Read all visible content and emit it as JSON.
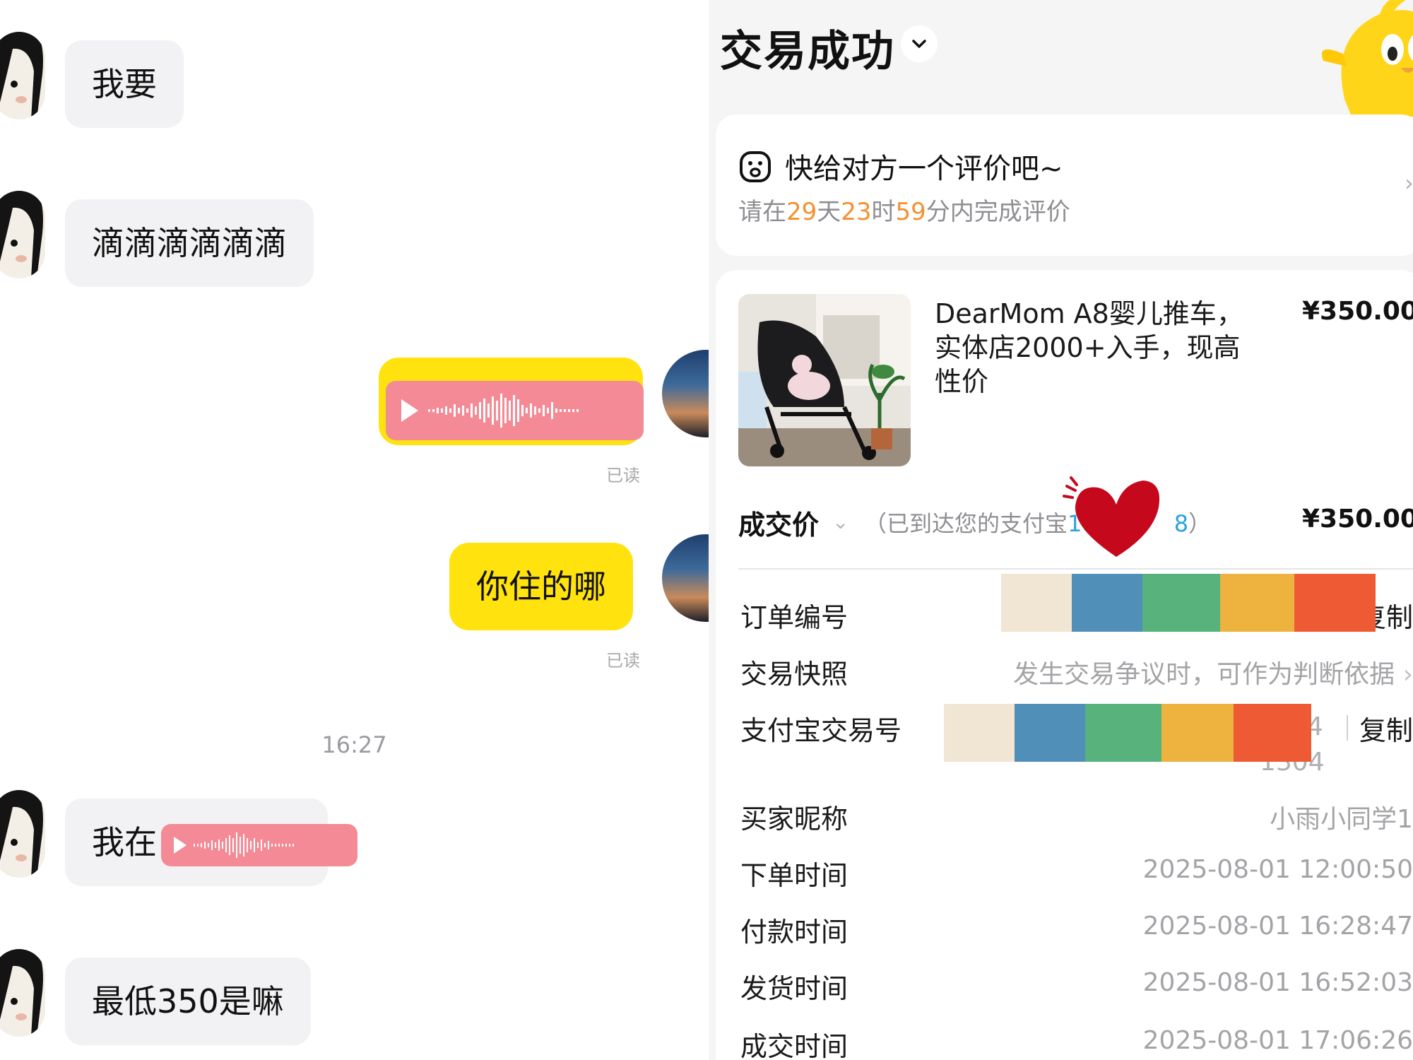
{
  "chat": {
    "messages_in": [
      {
        "text": "我要"
      },
      {
        "text": "滴滴滴滴滴滴"
      },
      {
        "text": "我在"
      },
      {
        "text": "最低350是嘛"
      }
    ],
    "messages_out": [
      {
        "kind": "voice"
      },
      {
        "text": "你住的哪"
      }
    ],
    "read_label": "已读",
    "timestamp": "16:27"
  },
  "order": {
    "status_title": "交易成功",
    "review": {
      "title": "快给对方一个评价吧~",
      "prefix": "请在",
      "days": "29",
      "days_unit": "天",
      "hours": "23",
      "hours_unit": "时",
      "minutes": "59",
      "minutes_unit": "分内完成评价"
    },
    "product": {
      "name": "DearMom A8婴儿推车，实体店2000+入手，现高性价",
      "price": "¥350.00"
    },
    "deal": {
      "label": "成交价",
      "note_prefix": "（已到达您的支付宝",
      "acct_start": "18",
      "acct_end": "8",
      "note_suffix": "）",
      "price": "¥350.00"
    },
    "rows": {
      "order_no_label": "订单编号",
      "copy_label": "复制",
      "snapshot_label": "交易快照",
      "snapshot_value": "发生交易争议时，可作为判断依据",
      "alipay_label": "支付宝交易号",
      "alipay_tail": "4",
      "alipay_tail2": "1304",
      "buyer_label": "买家昵称",
      "buyer_value": "小雨小同学1",
      "order_time_label": "下单时间",
      "order_time": "2025-08-01 12:00:50",
      "pay_time_label": "付款时间",
      "pay_time": "2025-08-01 16:28:47",
      "ship_time_label": "发货时间",
      "ship_time": "2025-08-01 16:52:03",
      "deal_time_label": "成交时间",
      "deal_time": "2025-08-01 17:06:26"
    }
  },
  "colors": {
    "accent_yellow": "#ffe20e",
    "highlight_orange": "#f5902f",
    "link_blue": "#2aa3df",
    "voice_pink": "#f48a96",
    "redact_palette": [
      "#f1e6d3",
      "#4f8fb8",
      "#58b27c",
      "#eeb23e",
      "#ee5a34"
    ]
  }
}
